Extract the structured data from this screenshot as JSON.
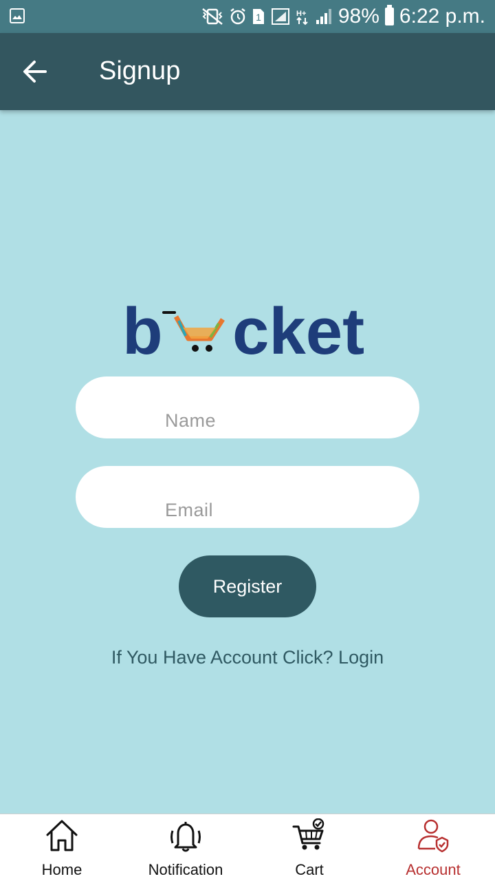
{
  "status_bar": {
    "battery_percent": "98%",
    "time": "6:22 p.m.",
    "sim_badge": "1",
    "network_type": "H+",
    "icons": [
      "photo-icon",
      "vibrate-off-icon",
      "alarm-icon",
      "sim-icon",
      "signal-icon",
      "data-icon",
      "signal-icon",
      "battery-icon"
    ]
  },
  "app_bar": {
    "title": "Signup",
    "back_icon": "arrow-left-icon"
  },
  "logo": {
    "text_left": "b",
    "text_right": "cket",
    "brand_color": "#1e3d7a"
  },
  "form": {
    "name_placeholder": "Name",
    "name_value": "",
    "email_placeholder": "Email",
    "email_value": "",
    "register_label": "Register",
    "login_prompt": "If You Have Account Click? Login"
  },
  "bottom_nav": {
    "items": [
      {
        "label": "Home",
        "icon": "home-icon",
        "active": false
      },
      {
        "label": "Notification",
        "icon": "bell-icon",
        "active": false
      },
      {
        "label": "Cart",
        "icon": "cart-icon",
        "active": false
      },
      {
        "label": "Account",
        "icon": "account-icon",
        "active": true
      }
    ],
    "active_color": "#b72f2f"
  },
  "colors": {
    "status_bar": "#457a84",
    "app_bar": "#33565f",
    "background": "#b0dfe5",
    "button": "#2f5962"
  }
}
